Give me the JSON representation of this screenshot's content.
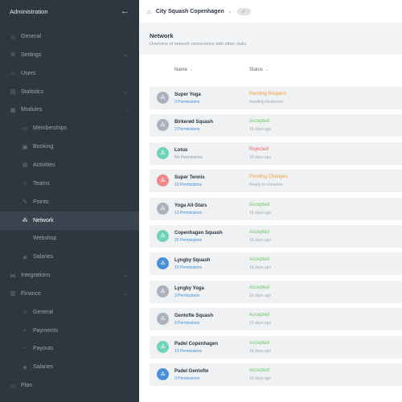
{
  "sidebar": {
    "title": "Administration",
    "back_icon": "arrow-left-icon",
    "items": [
      {
        "label": "General",
        "icon": "gauge-icon",
        "glyph": "◎",
        "type": "top"
      },
      {
        "label": "Settings",
        "icon": "gear-icon",
        "glyph": "⚙",
        "type": "top",
        "chevron": "⌄"
      },
      {
        "label": "Users",
        "icon": "users-icon",
        "glyph": "☺",
        "type": "top"
      },
      {
        "label": "Statistics",
        "icon": "chart-icon",
        "glyph": "▤",
        "type": "top",
        "chevron": "⌄"
      },
      {
        "label": "Modules",
        "icon": "modules-icon",
        "glyph": "▦",
        "type": "top",
        "chevron": "›"
      },
      {
        "label": "Memberships",
        "icon": "card-icon",
        "glyph": "▭",
        "type": "sub"
      },
      {
        "label": "Booking",
        "icon": "calendar-icon",
        "glyph": "▣",
        "type": "sub"
      },
      {
        "label": "Activities",
        "icon": "activities-icon",
        "glyph": "▤",
        "type": "sub"
      },
      {
        "label": "Teams",
        "icon": "teams-icon",
        "glyph": "☺",
        "type": "sub"
      },
      {
        "label": "Points",
        "icon": "points-icon",
        "glyph": "✎",
        "type": "sub"
      },
      {
        "label": "Network",
        "icon": "network-icon",
        "glyph": "⁂",
        "type": "sub",
        "active": true
      },
      {
        "label": "Webshop",
        "icon": "webshop-icon",
        "glyph": "◌",
        "type": "sub"
      },
      {
        "label": "Salaries",
        "icon": "salaries-icon",
        "glyph": "◈",
        "type": "sub"
      },
      {
        "label": "Integrations",
        "icon": "integrations-icon",
        "glyph": "⋈",
        "type": "top",
        "chevron": "⌄"
      },
      {
        "label": "Finance",
        "icon": "finance-icon",
        "glyph": "▥",
        "type": "top",
        "chevron": "⌄"
      },
      {
        "label": "General",
        "icon": "finance-general-icon",
        "glyph": "◇",
        "type": "sub"
      },
      {
        "label": "Payments",
        "icon": "payments-icon",
        "glyph": "+",
        "type": "sub"
      },
      {
        "label": "Payouts",
        "icon": "payouts-icon",
        "glyph": "−",
        "type": "sub"
      },
      {
        "label": "Salaries",
        "icon": "finance-salaries-icon",
        "glyph": "◈",
        "type": "sub"
      },
      {
        "label": "Plan",
        "icon": "plan-icon",
        "glyph": "▭",
        "type": "top"
      }
    ]
  },
  "header": {
    "home_icon": "home-icon",
    "club": "City Squash Copenhagen",
    "dropdown_icon": "chevron-down-icon",
    "toggle_icon": "check-icon"
  },
  "page": {
    "title": "Network",
    "subtitle": "Overview of network connections with other clubs"
  },
  "table": {
    "columns": {
      "name": "Name",
      "status": "Status"
    },
    "rows": [
      {
        "name": "Super Yoga",
        "permissions": "3 Permissions",
        "status": "Pending Request",
        "status_kind": "pending",
        "sub": "Awaiting Response",
        "avatar_color": "#aab3bd"
      },
      {
        "name": "Birkerød Squash",
        "permissions": "3 Permissions",
        "status": "Accepted",
        "status_kind": "accepted",
        "sub": "16 days ago",
        "avatar_color": "#aab3bd"
      },
      {
        "name": "Lotus",
        "permissions": "No Permissions",
        "status": "Rejected",
        "status_kind": "rejected",
        "sub": "16 days ago",
        "avatar_color": "#6fd3b5",
        "no_perm": true
      },
      {
        "name": "Super Tennis",
        "permissions": "10 Permissions",
        "status": "Pending Changes",
        "status_kind": "pending",
        "sub": "Ready to complete",
        "avatar_color": "#ec8a8a"
      },
      {
        "name": "Yoga All-Stars",
        "permissions": "13 Permissions",
        "status": "Accepted",
        "status_kind": "accepted",
        "sub": "16 days ago",
        "avatar_color": "#aab3bd"
      },
      {
        "name": "Copenhagen Squash",
        "permissions": "25 Permissions",
        "status": "Accepted",
        "status_kind": "accepted",
        "sub": "16 days ago",
        "avatar_color": "#6fd3b5"
      },
      {
        "name": "Lyngby Squash",
        "permissions": "10 Permissions",
        "status": "Accepted",
        "status_kind": "accepted",
        "sub": "16 days ago",
        "avatar_color": "#4a90d9"
      },
      {
        "name": "Lyngby Yoga",
        "permissions": "3 Permissions",
        "status": "Accepted",
        "status_kind": "accepted",
        "sub": "16 days ago",
        "avatar_color": "#aab3bd"
      },
      {
        "name": "Gentofte Squash",
        "permissions": "3 Permissions",
        "status": "Accepted",
        "status_kind": "accepted",
        "sub": "16 days ago",
        "avatar_color": "#aab3bd"
      },
      {
        "name": "Padel Copenhagen",
        "permissions": "13 Permissions",
        "status": "Accepted",
        "status_kind": "accepted",
        "sub": "16 days ago",
        "avatar_color": "#6fd3b5"
      },
      {
        "name": "Padel Gentofte",
        "permissions": "3 Permissions",
        "status": "Accepted",
        "status_kind": "accepted",
        "sub": "16 days ago",
        "avatar_color": "#4a90d9"
      }
    ]
  }
}
